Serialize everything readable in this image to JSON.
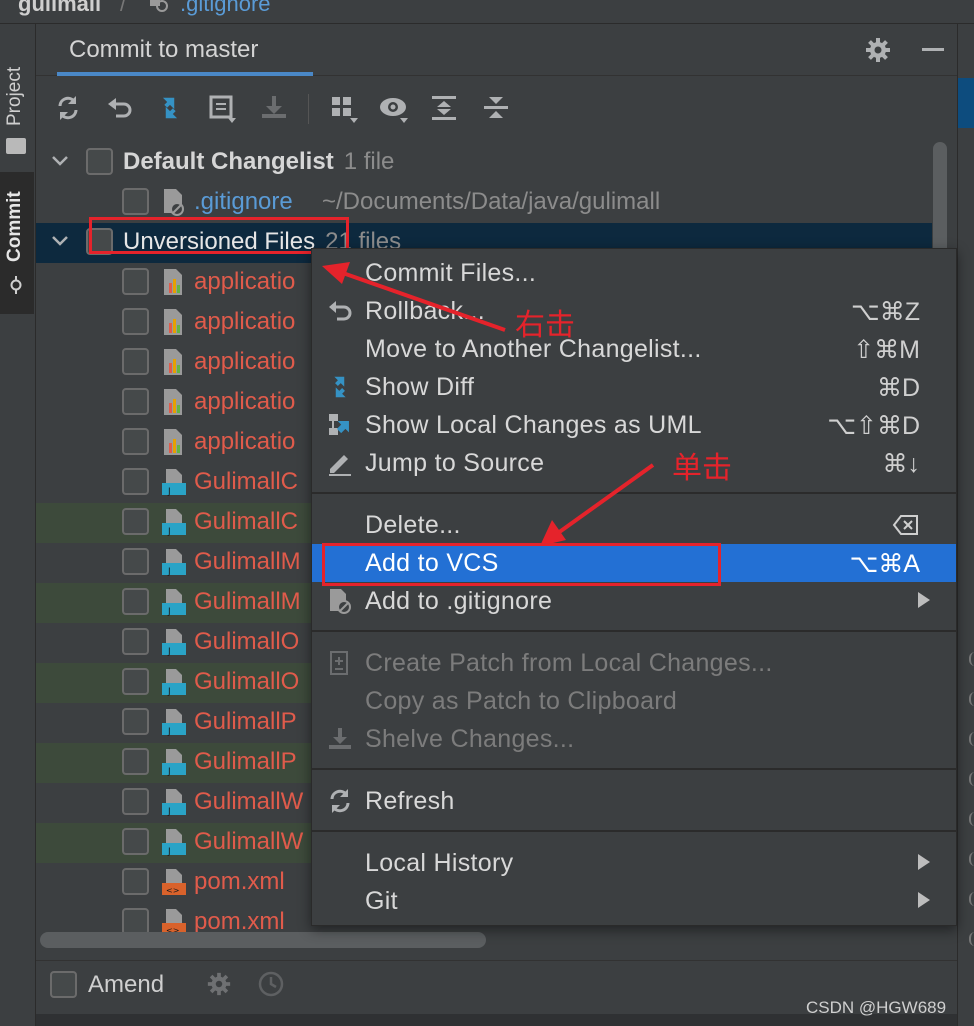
{
  "breadcrumb": {
    "project": "gulimall",
    "separator": "/",
    "file": ".gitignore"
  },
  "tool_windows": {
    "left": [
      "Project",
      "Commit"
    ],
    "active": "Commit"
  },
  "panel": {
    "title": "Commit to master",
    "toolbar": [
      "refresh-icon",
      "rollback-icon",
      "diff-icon",
      "changelist-icon",
      "shelve-icon",
      "group-by-icon",
      "eye-icon",
      "expand-all-icon",
      "collapse-all-icon"
    ]
  },
  "tree": {
    "groups": [
      {
        "name": "Default Changelist",
        "count": "1 file",
        "files": [
          {
            "name": ".gitignore",
            "path": "~/Documents/Data/java/gulimall",
            "color": "blue",
            "type": "ignore"
          }
        ]
      },
      {
        "name": "Unversioned Files",
        "count": "21 files",
        "files": [
          {
            "name": "applicatio",
            "type": "properties"
          },
          {
            "name": "applicatio",
            "type": "properties"
          },
          {
            "name": "applicatio",
            "type": "properties"
          },
          {
            "name": "applicatio",
            "type": "properties"
          },
          {
            "name": "applicatio",
            "type": "properties"
          },
          {
            "name": "GulimallC",
            "type": "java"
          },
          {
            "name": "GulimallC",
            "type": "java"
          },
          {
            "name": "GulimallM",
            "type": "java"
          },
          {
            "name": "GulimallM",
            "type": "java"
          },
          {
            "name": "GulimallO",
            "type": "java"
          },
          {
            "name": "GulimallO",
            "type": "java"
          },
          {
            "name": "GulimallP",
            "type": "java"
          },
          {
            "name": "GulimallP",
            "type": "java"
          },
          {
            "name": "GulimallW",
            "type": "java"
          },
          {
            "name": "GulimallW",
            "type": "java"
          },
          {
            "name": "pom.xml",
            "type": "xml"
          },
          {
            "name": "pom.xml",
            "type": "xml"
          }
        ]
      }
    ]
  },
  "amend": {
    "label": "Amend"
  },
  "context_menu": {
    "items": [
      {
        "label": "Commit Files...",
        "shortcut": "",
        "icon": ""
      },
      {
        "label": "Rollback...",
        "shortcut": "⌥⌘Z",
        "icon": "rollback-icon"
      },
      {
        "label": "Move to Another Changelist...",
        "shortcut": "⇧⌘M",
        "icon": ""
      },
      {
        "label": "Show Diff",
        "shortcut": "⌘D",
        "icon": "diff-icon"
      },
      {
        "label": "Show Local Changes as UML",
        "shortcut": "⌥⇧⌘D",
        "icon": "uml-icon"
      },
      {
        "label": "Jump to Source",
        "shortcut": "⌘↓",
        "icon": "edit-icon"
      },
      {
        "label": "Delete...",
        "shortcut": "",
        "icon": ""
      },
      {
        "label": "Add to VCS",
        "shortcut": "⌥⌘A",
        "icon": ""
      },
      {
        "label": "Add to .gitignore",
        "shortcut": "",
        "icon": "ignore-file-icon"
      },
      {
        "label": "Create Patch from Local Changes...",
        "shortcut": "",
        "icon": "patch-icon"
      },
      {
        "label": "Copy as Patch to Clipboard",
        "shortcut": "",
        "icon": ""
      },
      {
        "label": "Shelve Changes...",
        "shortcut": "",
        "icon": "shelve-icon"
      },
      {
        "label": "Refresh",
        "shortcut": "",
        "icon": "refresh-icon"
      },
      {
        "label": "Local History",
        "shortcut": "",
        "icon": ""
      },
      {
        "label": "Git",
        "shortcut": "",
        "icon": ""
      }
    ],
    "highlighted": "Add to VCS",
    "disabled": [
      "Create Patch from Local Changes...",
      "Copy as Patch to Clipboard",
      "Shelve Changes..."
    ]
  },
  "annotations": {
    "right_click": "右击",
    "single_click": "单击",
    "color": "#e5232b"
  },
  "watermark": "CSDN @HGW689",
  "colors": {
    "selection": "#2370d4",
    "unversioned": "#e05b4b",
    "ignored": "#5a9bd6",
    "background": "#3c3f41"
  }
}
